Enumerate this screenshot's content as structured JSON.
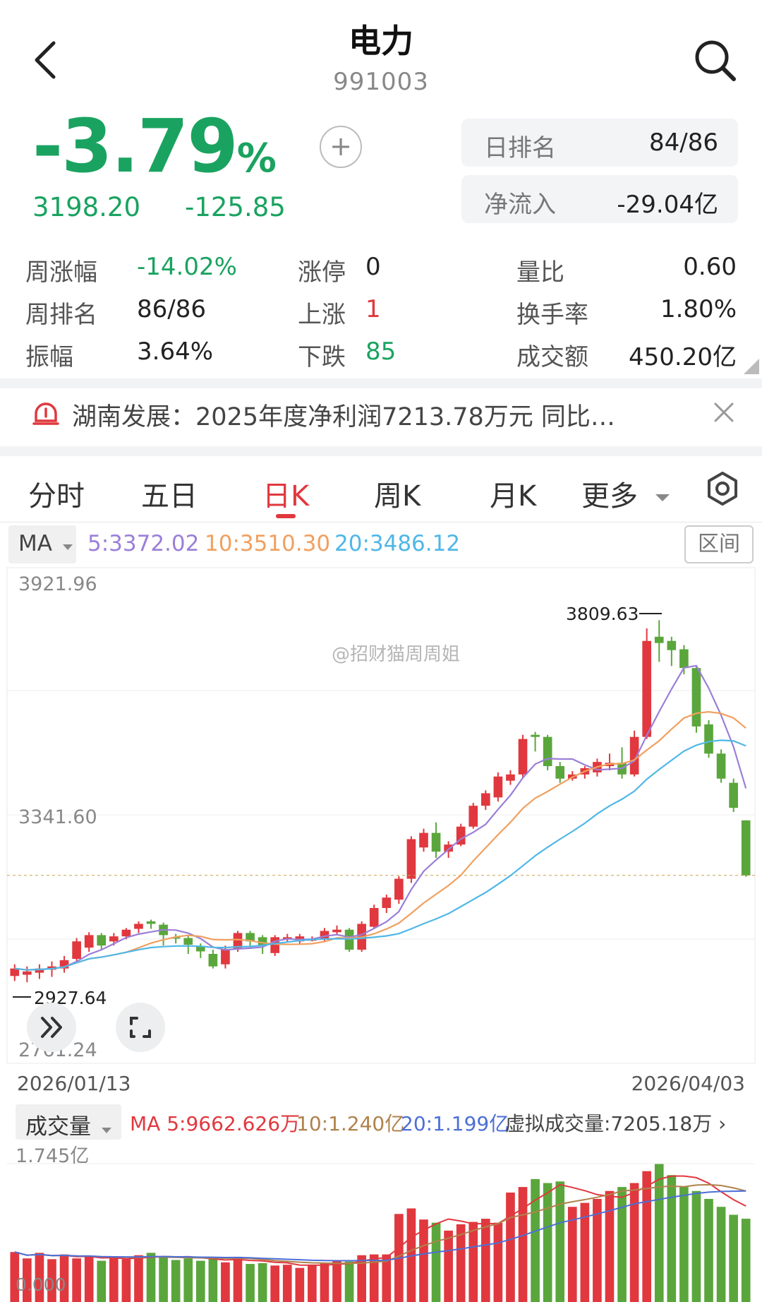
{
  "header": {
    "title": "电力",
    "code": "991003"
  },
  "quote": {
    "pct_change": "-3.79",
    "pct_unit": "%",
    "price": "3198.20",
    "change": "-125.85",
    "day_rank_label": "日排名",
    "day_rank_value": "84/86",
    "net_inflow_label": "净流入",
    "net_inflow_value": "-29.04亿"
  },
  "stats": [
    {
      "label": "周涨幅",
      "value": "-14.02%"
    },
    {
      "label": "周排名",
      "value": "86/86"
    },
    {
      "label": "振幅",
      "value": "3.64%"
    },
    {
      "label": "涨停",
      "value": "0"
    },
    {
      "label": "上涨",
      "value": "1"
    },
    {
      "label": "下跌",
      "value": "85"
    },
    {
      "label": "量比",
      "value": "0.60"
    },
    {
      "label": "换手率",
      "value": "1.80%"
    },
    {
      "label": "成交额",
      "value": "450.20亿"
    }
  ],
  "news": {
    "text": "湖南发展：2025年度净利润7213.78万元  同比…"
  },
  "tabs": [
    "分时",
    "五日",
    "日K",
    "周K",
    "月K",
    "更多"
  ],
  "active_tab": "日K",
  "ma_bar": {
    "selector": "MA",
    "ma5": "5:3372.02",
    "ma10": "10:3510.30",
    "ma20": "20:3486.12",
    "range_button": "区间"
  },
  "price_chart": {
    "y_top": "3921.96",
    "y_mid": "3341.60",
    "y_bottom": "2761.24",
    "high_marker": "3809.63",
    "low_marker": "2927.64",
    "date_start": "2026/01/13",
    "date_end": "2026/04/03",
    "watermark": "@招财猫周周姐"
  },
  "volume": {
    "selector": "成交量",
    "ma5": "MA 5:9662.626万",
    "ma10": "10:1.240亿",
    "ma20": "20:1.199亿",
    "virtual": "虚拟成交量:7205.18万",
    "y_top": "1.745亿",
    "y_bottom": "0.000"
  },
  "colors": {
    "up": "#e0383e",
    "down": "#5aa63c",
    "ma5": "#9b7fd8",
    "ma10": "#f0a060",
    "ma20": "#4fb7e6",
    "green_text": "#1aa360"
  },
  "chart_data": {
    "type": "candlestick",
    "ylim": [
      2761.24,
      3921.96
    ],
    "candles": [
      [
        2957,
        2975,
        2945,
        2985
      ],
      [
        2960,
        2968,
        2942,
        2980
      ],
      [
        2965,
        2975,
        2950,
        2985
      ],
      [
        2972,
        2980,
        2955,
        2992
      ],
      [
        2975,
        2995,
        2965,
        3005
      ],
      [
        2998,
        3040,
        2990,
        3048
      ],
      [
        3025,
        3055,
        3015,
        3062
      ],
      [
        3055,
        3030,
        3020,
        3060
      ],
      [
        3040,
        3052,
        3030,
        3060
      ],
      [
        3052,
        3068,
        3045,
        3072
      ],
      [
        3070,
        3082,
        3060,
        3088
      ],
      [
        3088,
        3082,
        3070,
        3092
      ],
      [
        3080,
        3055,
        3030,
        3085
      ],
      [
        3050,
        3048,
        3035,
        3058
      ],
      [
        3048,
        3032,
        3010,
        3055
      ],
      [
        3028,
        3016,
        3000,
        3035
      ],
      [
        3010,
        2980,
        2975,
        3020
      ],
      [
        2985,
        3022,
        2975,
        3030
      ],
      [
        3022,
        3060,
        3015,
        3065
      ],
      [
        3060,
        3040,
        3025,
        3065
      ],
      [
        3050,
        3030,
        3010,
        3055
      ],
      [
        3012,
        3050,
        3005,
        3055
      ],
      [
        3045,
        3050,
        3038,
        3058
      ],
      [
        3040,
        3052,
        3032,
        3058
      ],
      [
        3045,
        3045,
        3040,
        3052
      ],
      [
        3045,
        3065,
        3040,
        3072
      ],
      [
        3062,
        3068,
        3055,
        3078
      ],
      [
        3068,
        3020,
        3015,
        3072
      ],
      [
        3020,
        3082,
        3015,
        3088
      ],
      [
        3075,
        3120,
        3070,
        3128
      ],
      [
        3120,
        3145,
        3108,
        3152
      ],
      [
        3140,
        3190,
        3130,
        3196
      ],
      [
        3190,
        3285,
        3180,
        3292
      ],
      [
        3265,
        3300,
        3255,
        3310
      ],
      [
        3300,
        3255,
        3240,
        3325
      ],
      [
        3255,
        3272,
        3240,
        3280
      ],
      [
        3272,
        3315,
        3268,
        3322
      ],
      [
        3315,
        3365,
        3310,
        3372
      ],
      [
        3365,
        3395,
        3355,
        3402
      ],
      [
        3385,
        3435,
        3375,
        3445
      ],
      [
        3425,
        3440,
        3415,
        3450
      ],
      [
        3440,
        3525,
        3430,
        3535
      ],
      [
        3535,
        3530,
        3495,
        3542
      ],
      [
        3530,
        3460,
        3450,
        3535
      ],
      [
        3460,
        3430,
        3420,
        3470
      ],
      [
        3430,
        3440,
        3425,
        3448
      ],
      [
        3440,
        3455,
        3430,
        3460
      ],
      [
        3445,
        3470,
        3435,
        3478
      ],
      [
        3460,
        3468,
        3450,
        3490
      ],
      [
        3468,
        3440,
        3430,
        3505
      ],
      [
        3440,
        3530,
        3435,
        3545
      ],
      [
        3530,
        3760,
        3525,
        3790
      ],
      [
        3770,
        3755,
        3710,
        3809.63
      ],
      [
        3760,
        3738,
        3700,
        3770
      ],
      [
        3740,
        3695,
        3680,
        3750
      ],
      [
        3695,
        3555,
        3540,
        3700
      ],
      [
        3560,
        3490,
        3480,
        3570
      ],
      [
        3490,
        3430,
        3420,
        3500
      ],
      [
        3420,
        3360,
        3350,
        3430
      ],
      [
        3330,
        3198.2,
        3195,
        3330
      ]
    ],
    "volume_ylim": [
      0,
      1.745
    ],
    "volumes": [
      0.63,
      0.55,
      0.62,
      0.54,
      0.6,
      0.55,
      0.57,
      0.52,
      0.55,
      0.54,
      0.59,
      0.62,
      0.57,
      0.53,
      0.55,
      0.52,
      0.55,
      0.5,
      0.57,
      0.48,
      0.49,
      0.46,
      0.47,
      0.43,
      0.47,
      0.49,
      0.52,
      0.51,
      0.59,
      0.6,
      0.6,
      1.11,
      1.18,
      1.04,
      1.0,
      0.9,
      0.98,
      1.01,
      1.05,
      1.0,
      1.38,
      1.45,
      1.55,
      1.5,
      1.52,
      1.2,
      1.25,
      1.3,
      1.4,
      1.45,
      1.5,
      1.65,
      1.74,
      1.6,
      1.45,
      1.4,
      1.3,
      1.2,
      1.1,
      1.05
    ]
  }
}
